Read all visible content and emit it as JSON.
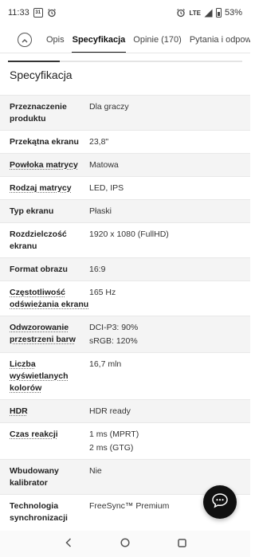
{
  "status_bar": {
    "time": "11:33",
    "calendar_day": "31",
    "network": "LTE",
    "battery": "53%"
  },
  "tabs": [
    {
      "label": "Opis",
      "active": false
    },
    {
      "label": "Specyfikacja",
      "active": true
    },
    {
      "label": "Opinie (170)",
      "active": false
    },
    {
      "label": "Pytania i odpowiedz",
      "active": false
    }
  ],
  "section": {
    "title": "Specyfikacja",
    "scroll_progress": 0.22
  },
  "specs": [
    {
      "label": "Przeznaczenie produktu",
      "values": [
        "Dla graczy"
      ],
      "dotted": false
    },
    {
      "label": "Przekątna ekranu",
      "values": [
        "23,8\""
      ],
      "dotted": false
    },
    {
      "label": "Powłoka matrycy",
      "values": [
        "Matowa"
      ],
      "dotted": true
    },
    {
      "label": "Rodzaj matrycy",
      "values": [
        "LED, IPS"
      ],
      "dotted": true
    },
    {
      "label": "Typ ekranu",
      "values": [
        "Płaski"
      ],
      "dotted": false
    },
    {
      "label": "Rozdzielczość ekranu",
      "values": [
        "1920 x 1080 (FullHD)"
      ],
      "dotted": false
    },
    {
      "label": "Format obrazu",
      "values": [
        "16:9"
      ],
      "dotted": false
    },
    {
      "label": "Częstotliwość odświeżania ekranu",
      "values": [
        "165 Hz"
      ],
      "dotted": true
    },
    {
      "label": "Odwzorowanie przestrzeni barw",
      "values": [
        "DCI-P3: 90%",
        "sRGB: 120%"
      ],
      "dotted": true
    },
    {
      "label": "Liczba wyświetlanych kolorów",
      "values": [
        "16,7 mln"
      ],
      "dotted": true
    },
    {
      "label": "HDR",
      "values": [
        "HDR ready"
      ],
      "dotted": true
    },
    {
      "label": "Czas reakcji",
      "values": [
        "1 ms (MPRT)",
        "2 ms (GTG)"
      ],
      "dotted": true
    },
    {
      "label": "Wbudowany kalibrator",
      "values": [
        "Nie"
      ],
      "dotted": false
    },
    {
      "label": "Technologia synchronizacji",
      "values": [
        "FreeSync™ Premium"
      ],
      "dotted": false
    }
  ]
}
